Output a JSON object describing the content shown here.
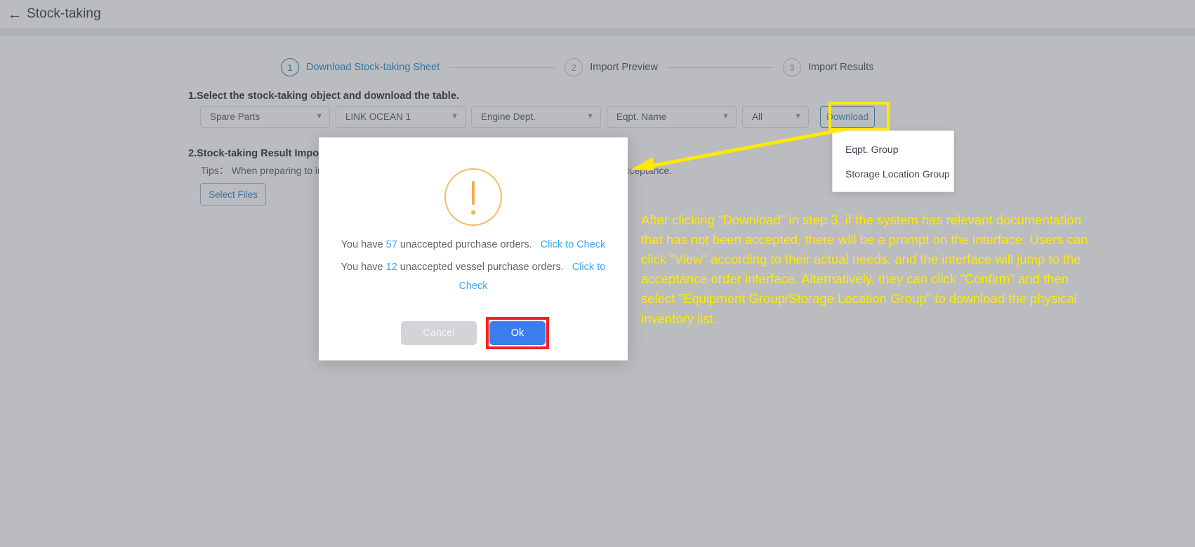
{
  "titlebar": {
    "back_icon": "back-arrow-icon",
    "title": "Stock-taking"
  },
  "stepper": {
    "steps": [
      {
        "num": "1",
        "label": "Download Stock-taking Sheet",
        "active": true
      },
      {
        "num": "2",
        "label": "Import Preview",
        "active": false
      },
      {
        "num": "3",
        "label": "Import Results",
        "active": false
      }
    ]
  },
  "section1": {
    "heading": "1.Select the stock-taking object and download the table.",
    "filters": [
      {
        "name": "object-type",
        "value": "Spare Parts"
      },
      {
        "name": "vessel",
        "value": "LINK OCEAN 1"
      },
      {
        "name": "department",
        "value": "Engine Dept."
      },
      {
        "name": "equipment-name",
        "value": "Eqpt. Name"
      },
      {
        "name": "scope",
        "value": "All"
      }
    ],
    "download_label": "Download",
    "caret_icon": "chevron-down-icon"
  },
  "download_menu": {
    "items": [
      "Eqpt. Group",
      "Storage Location Group"
    ]
  },
  "section2": {
    "heading": "2.Stock-taking Result Import",
    "tips": "Tips： When preparing to import, please ensure that all purchase orders have completed online acceptance.",
    "select_files_label": "Select Files"
  },
  "modal": {
    "icon": "warning-exclamation-icon",
    "line1_prefix": "You have ",
    "line1_count": "57",
    "line1_suffix": " unaccepted purchase orders.",
    "line1_link": "Click to Check",
    "line2_prefix": "You have ",
    "line2_count": "12",
    "line2_suffix": " unaccepted vessel purchase orders.",
    "line2_link": "Click to Check",
    "cancel_label": "Cancel",
    "ok_label": "Ok"
  },
  "annotation": {
    "text": "After clicking \"Download\" in step 3, if the system has relevant documentation that has not been accepted, there will be a prompt on the interface. Users can click \"View\" according to their actual needs, and the interface will jump to the acceptance order interface. Alternatively, they can click \"Confirm\" and then select \"Equipment Group/Storage Location Group\" to download the physical inventory list.",
    "highlight_color": "#ffe900",
    "emphasis_color": "#f42121"
  }
}
